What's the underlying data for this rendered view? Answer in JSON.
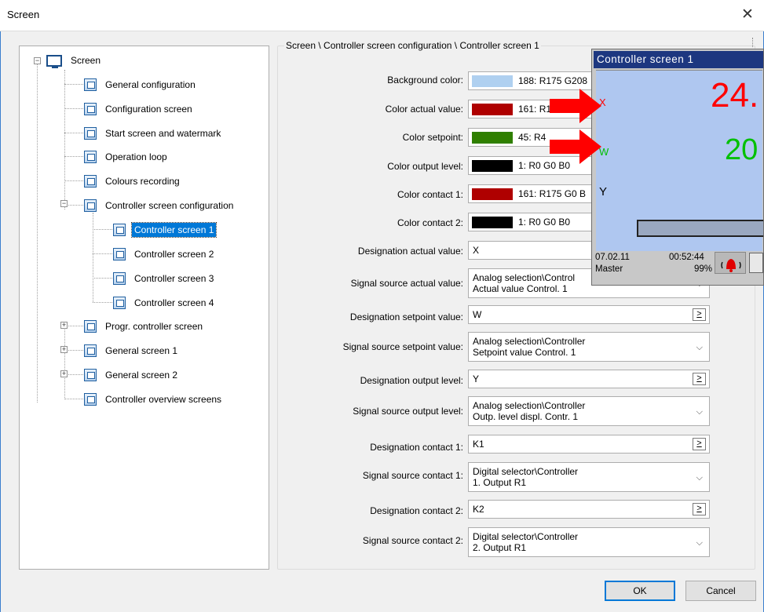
{
  "window": {
    "title": "Screen",
    "close_glyph": "✕"
  },
  "tree": {
    "root": {
      "label": "Screen",
      "icon": "monitor-icon"
    },
    "items": [
      {
        "label": "General configuration",
        "icon": "settings-icon"
      },
      {
        "label": "Configuration screen",
        "icon": "config-grid-icon"
      },
      {
        "label": "Start screen and watermark",
        "icon": "image-icon"
      },
      {
        "label": "Operation loop",
        "icon": "loop-icon"
      },
      {
        "label": "Colours recording",
        "icon": "palette-icon"
      },
      {
        "label": "Controller screen configuration",
        "icon": "controller-icon"
      },
      {
        "label": "Controller screen 1",
        "icon": "controller-screen-icon",
        "selected": true
      },
      {
        "label": "Controller screen 2",
        "icon": "controller-screen-icon"
      },
      {
        "label": "Controller screen 3",
        "icon": "controller-screen-icon"
      },
      {
        "label": "Controller screen 4",
        "icon": "controller-screen-icon"
      },
      {
        "label": "Progr. controller screen",
        "icon": "program-controller-icon"
      },
      {
        "label": "General screen 1",
        "icon": "trend-icon"
      },
      {
        "label": "General screen 2",
        "icon": "trend-icon"
      },
      {
        "label": "Controller overview screens",
        "icon": "overview-icon"
      }
    ],
    "expander_plus": "+",
    "expander_minus": "−"
  },
  "form": {
    "breadcrumb": "Screen \\ Controller screen configuration \\ Controller screen 1",
    "background_color": {
      "label": "Background color:",
      "value": "188: R175 G208",
      "swatch": "#afd0f0"
    },
    "color_actual": {
      "label": "Color actual value:",
      "value": "161: R1",
      "swatch": "#af0000"
    },
    "color_setpoint": {
      "label": "Color setpoint:",
      "value": "45: R4",
      "swatch": "#2f7f00"
    },
    "color_output": {
      "label": "Color output level:",
      "value": "1: R0 G0 B0",
      "swatch": "#000000"
    },
    "color_contact1": {
      "label": "Color contact 1:",
      "value": "161: R175 G0 B",
      "swatch": "#af0000"
    },
    "color_contact2": {
      "label": "Color contact 2:",
      "value": "1: R0 G0 B0",
      "swatch": "#000000"
    },
    "designation_actual": {
      "label": "Designation actual value:",
      "value": "X"
    },
    "source_actual": {
      "label": "Signal source actual value:",
      "line1": "Analog selection\\Control",
      "line2": "Actual value Control. 1"
    },
    "designation_setpoint": {
      "label": "Designation setpoint value:",
      "value": "W"
    },
    "source_setpoint": {
      "label": "Signal source setpoint value:",
      "line1": "Analog selection\\Controller",
      "line2": "Setpoint value Control. 1"
    },
    "designation_output": {
      "label": "Designation output level:",
      "value": "Y"
    },
    "source_output": {
      "label": "Signal source output level:",
      "line1": "Analog selection\\Controller",
      "line2": "Outp. level displ. Contr. 1"
    },
    "designation_contact1": {
      "label": "Designation contact 1:",
      "value": "K1"
    },
    "source_contact1": {
      "label": "Signal source contact 1:",
      "line1": "Digital selector\\Controller",
      "line2": "1. Output R1"
    },
    "designation_contact2": {
      "label": "Designation contact 2:",
      "value": "K2"
    },
    "source_contact2": {
      "label": "Signal source contact 2:",
      "line1": "Digital selector\\Controller",
      "line2": "2. Output R1"
    },
    "browse_glyph": ">",
    "chevron_glyph": "⌵"
  },
  "preview": {
    "title": "Controller screen 1",
    "x_label": "X",
    "w_label": "W",
    "y_label": "Y",
    "actual_value": "24.",
    "setpoint_value": "20",
    "date": "07.02.11",
    "time": "00:52:44",
    "user": "Master",
    "memory": "99%",
    "colors": {
      "actual": "#ff0000",
      "setpoint": "#00c000",
      "arrow": "#ff0000"
    }
  },
  "buttons": {
    "ok": "OK",
    "cancel": "Cancel"
  }
}
